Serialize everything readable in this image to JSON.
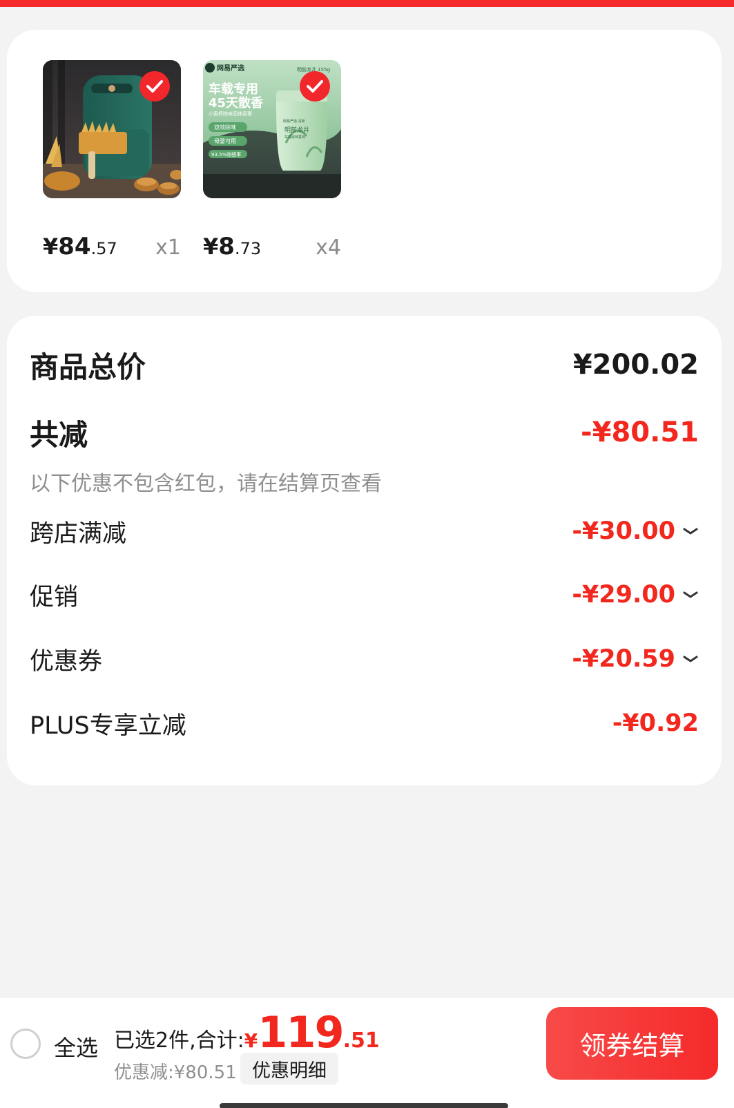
{
  "products": [
    {
      "name": "air-fryer",
      "price_yen": "¥",
      "price_int": "84",
      "price_dec": ".57",
      "quantity": "x1"
    },
    {
      "name": "car-fragrance",
      "price_yen": "¥",
      "price_int": "8",
      "price_dec": ".73",
      "quantity": "x4",
      "img_text": {
        "brand": "网易严选",
        "weight": "明前龙井 155g",
        "line1": "车载专用",
        "line2": "45天散香",
        "sub": "小香杯除味固体香膏",
        "tag1": "双效除味",
        "tag2": "母婴可用",
        "tag3": "93.5%除醛率",
        "jar_brand": "网易严选·清新",
        "jar_text": "明前龙井",
        "jar_sub": "车载除味香膏"
      }
    }
  ],
  "summary": {
    "total_label": "商品总价",
    "total_value": "¥200.02",
    "reduce_label": "共减",
    "reduce_value": "-¥80.51",
    "hint": "以下优惠不包含红包，请在结算页查看",
    "items": [
      {
        "label": "跨店满减",
        "value": "-¥30.00",
        "expandable": true
      },
      {
        "label": "促销",
        "value": "-¥29.00",
        "expandable": true
      },
      {
        "label": "优惠券",
        "value": "-¥20.59",
        "expandable": true
      },
      {
        "label": "PLUS专享立减",
        "value": "-¥0.92",
        "expandable": false
      }
    ]
  },
  "bottom_bar": {
    "select_all": "全选",
    "selected_text": "已选2件,合计:",
    "total_yen": "¥",
    "total_int": "119",
    "total_dec": ".51",
    "discount_text": "优惠减:¥80.51",
    "detail_button": "优惠明细",
    "checkout_button": "领券结算"
  },
  "colors": {
    "accent_red": "#f2271d",
    "checkout_red": "#f52a2a"
  }
}
